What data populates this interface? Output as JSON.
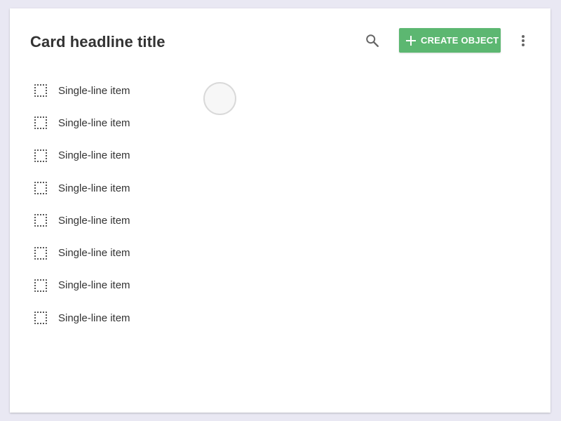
{
  "card": {
    "title": "Card headline title",
    "actions": {
      "search_icon": "search-icon",
      "create_label": "CREATE OBJECT",
      "create_icon": "plus-icon",
      "more_icon": "more-vert-icon"
    },
    "items": [
      {
        "label": "Single-line item",
        "checked": false
      },
      {
        "label": "Single-line item",
        "checked": false
      },
      {
        "label": "Single-line item",
        "checked": false
      },
      {
        "label": "Single-line item",
        "checked": false
      },
      {
        "label": "Single-line item",
        "checked": false
      },
      {
        "label": "Single-line item",
        "checked": false
      },
      {
        "label": "Single-line item",
        "checked": false
      },
      {
        "label": "Single-line item",
        "checked": false
      }
    ]
  },
  "colors": {
    "background": "#e9e8f3",
    "card": "#ffffff",
    "accent_button": "#5cb771",
    "text": "#333333",
    "icon": "#666666"
  }
}
